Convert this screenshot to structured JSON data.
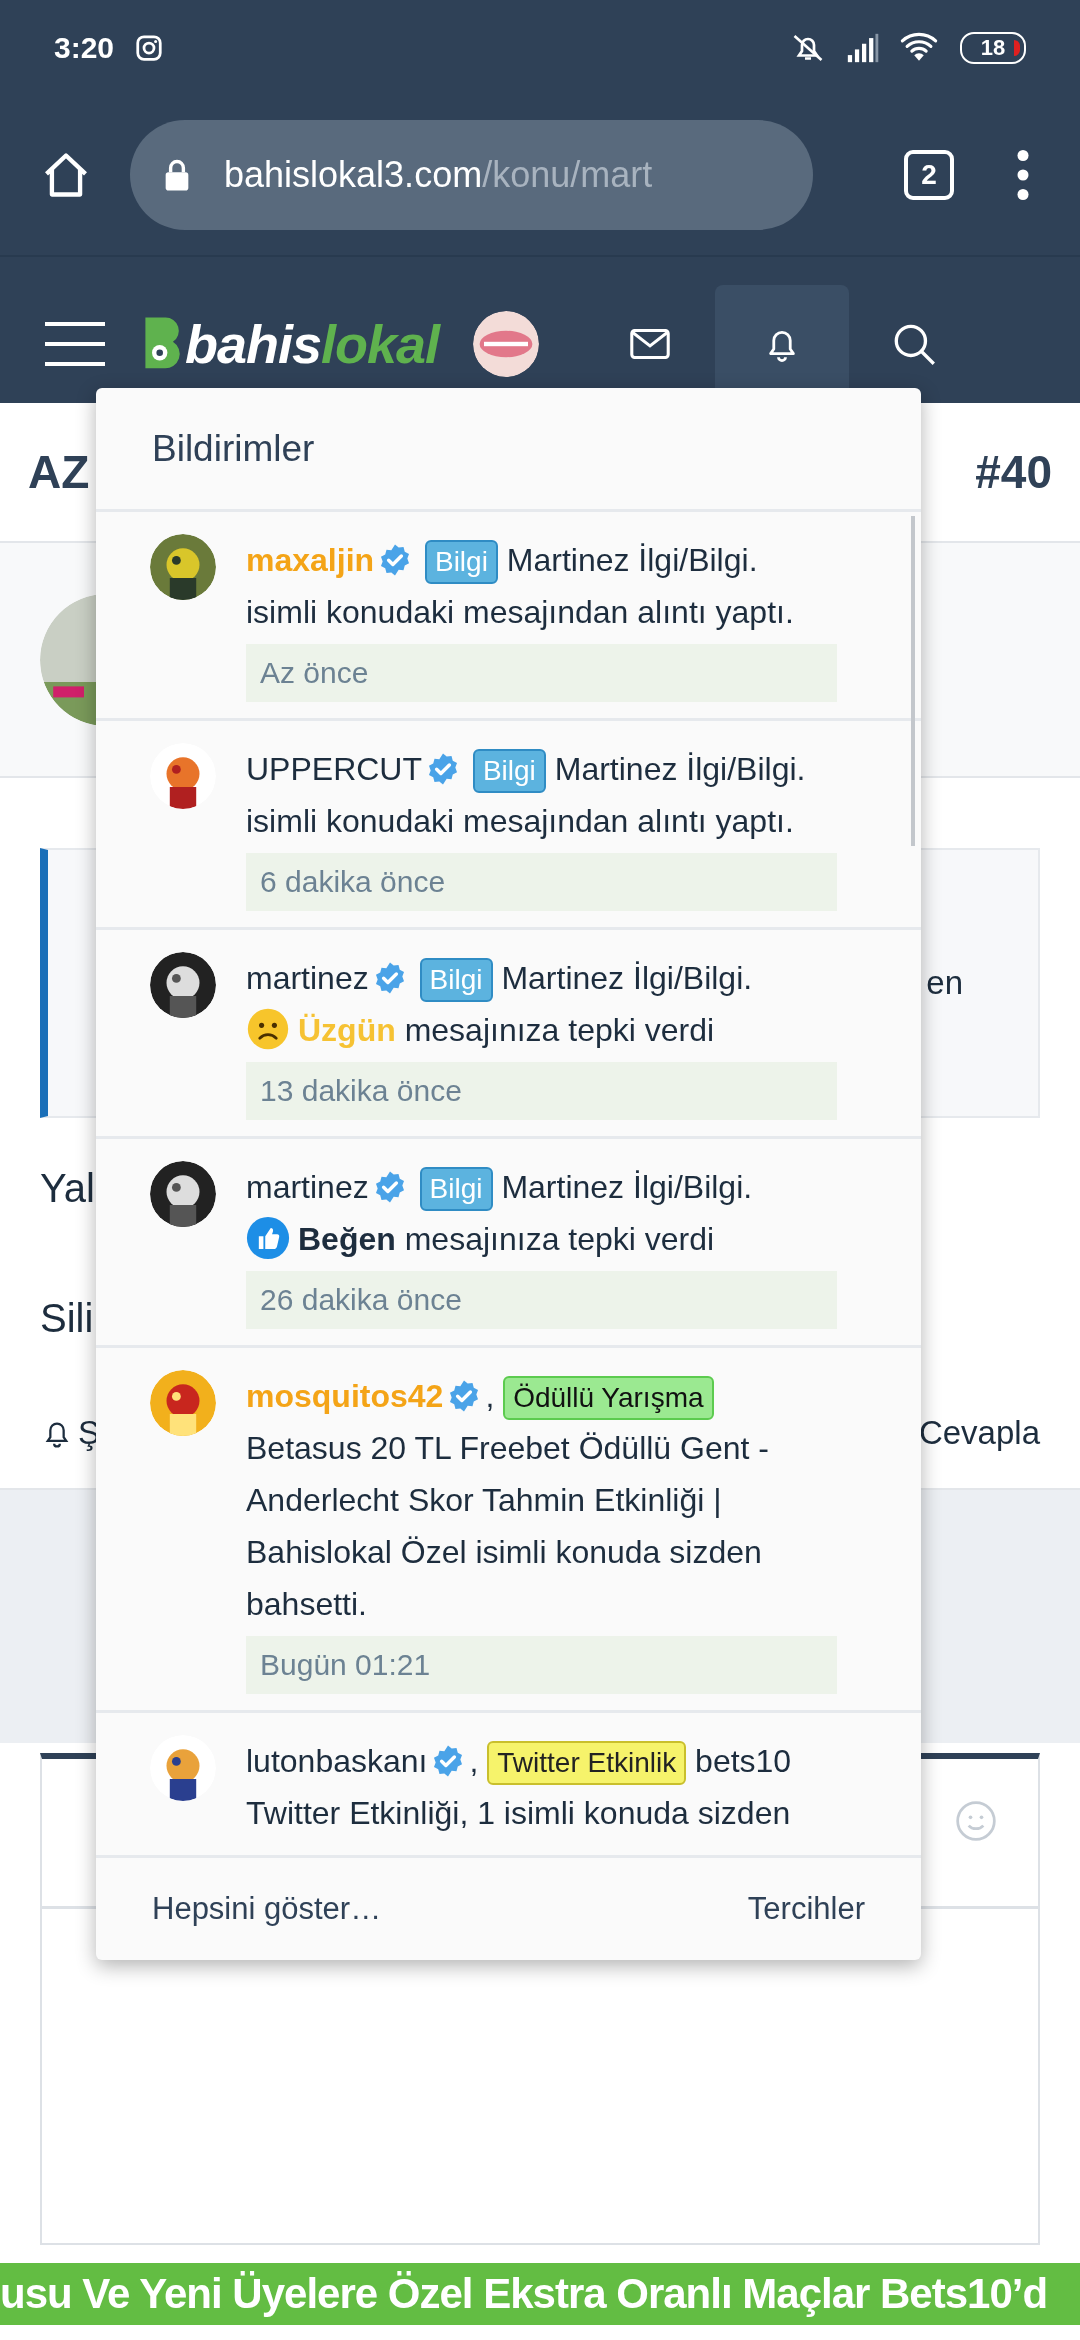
{
  "status_bar": {
    "time": "3:20",
    "battery": "18"
  },
  "browser": {
    "url_domain": "bahislokal3.com",
    "url_path": "/konu/mart",
    "tab_count": "2"
  },
  "site_header": {
    "logo_part_1": "bahis",
    "logo_part_2": "lokal",
    "alerts_open": true
  },
  "thread": {
    "title": "AZ",
    "post_number": "#40",
    "quote_text": "en",
    "line_1": "Yal",
    "line_2": "Sili",
    "watch": "Ş",
    "reply": "Cevapla"
  },
  "notifications": {
    "title": "Bildirimler",
    "items": [
      {
        "user": "maxaljin",
        "name_highlighted": true,
        "verified": true,
        "tag": {
          "label": "Bilgi",
          "kind": "info"
        },
        "topic": "Martinez İlgi/Bilgi.",
        "message": "isimli konudaki mesajından alıntı yaptı.",
        "time": "Az önce"
      },
      {
        "user": "UPPERCUT",
        "name_highlighted": false,
        "verified": true,
        "tag": {
          "label": "Bilgi",
          "kind": "info"
        },
        "topic": "Martinez İlgi/Bilgi.",
        "message": "isimli konudaki mesajından alıntı yaptı.",
        "time": "6 dakika önce"
      },
      {
        "user": "martinez",
        "name_highlighted": false,
        "verified": true,
        "tag": {
          "label": "Bilgi",
          "kind": "info"
        },
        "topic": "Martinez İlgi/Bilgi.",
        "reaction": {
          "kind": "sad",
          "label": "Üzgün"
        },
        "message": "mesajınıza tepki verdi",
        "time": "13 dakika önce"
      },
      {
        "user": "martinez",
        "name_highlighted": false,
        "verified": true,
        "tag": {
          "label": "Bilgi",
          "kind": "info"
        },
        "topic": "Martinez İlgi/Bilgi.",
        "reaction": {
          "kind": "like",
          "label": "Beğen"
        },
        "message": "mesajınıza tepki verdi",
        "time": "26 dakika önce"
      },
      {
        "user": "mosquitos42",
        "name_highlighted": true,
        "verified": true,
        "separator": ",",
        "tag": {
          "label": "Ödüllü Yarışma",
          "kind": "prize"
        },
        "topic": "Betasus 20 TL Freebet Ödüllü Gent - Anderlecht Skor Tahmin Etkinliği | Bahislokal Özel",
        "message": "isimli konuda sizden bahsetti.",
        "time": "Bugün 01:21"
      },
      {
        "user": "lutonbaskanı",
        "name_highlighted": false,
        "verified": true,
        "separator": ",",
        "tag": {
          "label": "Twitter Etkinlik",
          "kind": "twitter"
        },
        "topic": "bets10 Twitter Etkinliği, 1",
        "message": "isimli konuda sizden"
      }
    ],
    "footer_left": "Hepsini göster…",
    "footer_right": "Tercihler"
  },
  "ticker": "usu Ve Yeni Üyelere Özel Ekstra Oranlı Maçlar Bets10’d"
}
